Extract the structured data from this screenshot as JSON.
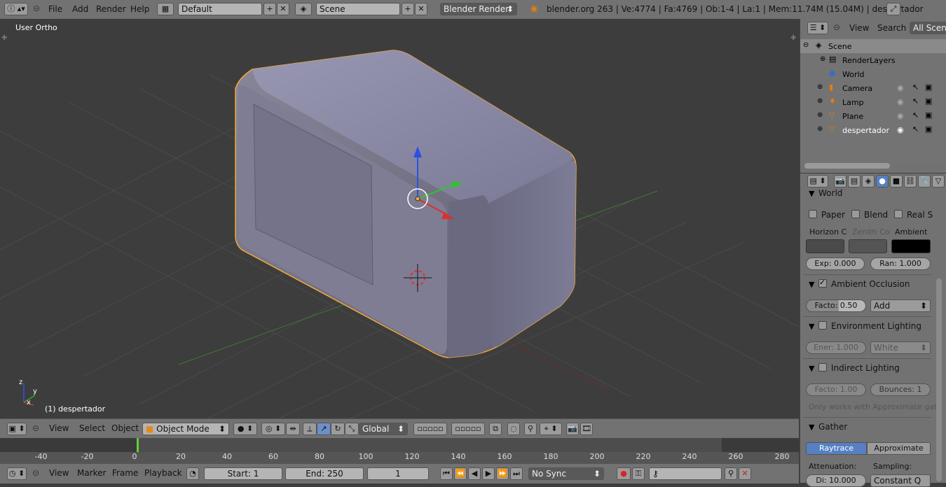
{
  "topbar": {
    "menus": [
      "File",
      "Add",
      "Render",
      "Help"
    ],
    "screen_layout": "Default",
    "scene": "Scene",
    "render_engine": "Blender Render",
    "status": "blender.org 263 | Ve:4774 | Fa:4769 | Ob:1-4 | La:1 | Mem:11.74M (15.04M) | despertador"
  },
  "viewport": {
    "view_label": "User Ortho",
    "object_label": "(1) despertador"
  },
  "view3d_header": {
    "menus": [
      "View",
      "Select",
      "Object"
    ],
    "mode": "Object Mode",
    "orientation": "Global"
  },
  "timeline": {
    "ticks": [
      "-40",
      "-20",
      "0",
      "20",
      "40",
      "60",
      "80",
      "100",
      "120",
      "140",
      "160",
      "180",
      "200",
      "220",
      "240",
      "260",
      "280"
    ],
    "menus": [
      "View",
      "Marker",
      "Frame",
      "Playback"
    ],
    "start": "Start: 1",
    "end": "End: 250",
    "current": "1",
    "sync": "No Sync"
  },
  "outliner": {
    "menus": [
      "View",
      "Search"
    ],
    "filter": "All Scenes",
    "items": [
      {
        "label": "Scene"
      },
      {
        "label": "RenderLayers"
      },
      {
        "label": "World"
      },
      {
        "label": "Camera"
      },
      {
        "label": "Lamp"
      },
      {
        "label": "Plane"
      },
      {
        "label": "despertador"
      }
    ]
  },
  "properties": {
    "world_title": "World",
    "checks": [
      "Paper",
      "Blend",
      "Real S"
    ],
    "colors": {
      "horizon_label": "Horizon C",
      "zenith_label": "Zenith Co",
      "ambient_label": "Ambient"
    },
    "exposure": "Exp: 0.000",
    "range": "Ran: 1.000",
    "ao": {
      "title": "Ambient Occlusion",
      "factor_label": "Facto:",
      "factor_value": "0.50",
      "blend": "Add"
    },
    "env": {
      "title": "Environment Lighting",
      "energy": "Ener: 1.000",
      "source": "White"
    },
    "indirect": {
      "title": "Indirect Lighting",
      "factor": "Facto: 1.00",
      "bounces": "Bounces: 1",
      "note": "Only works with Approximate gat"
    },
    "gather": {
      "title": "Gather",
      "raytrace": "Raytrace",
      "approximate": "Approximate",
      "attenuation_label": "Attenuation:",
      "sampling_label": "Sampling:",
      "dist": "Di: 10.000",
      "sampling": "Constant Q"
    }
  },
  "axis_widget": {
    "x": "x",
    "y": "y",
    "z": "z"
  },
  "colors": {
    "accent": "#5680c2",
    "selection": "#f1a93a"
  }
}
